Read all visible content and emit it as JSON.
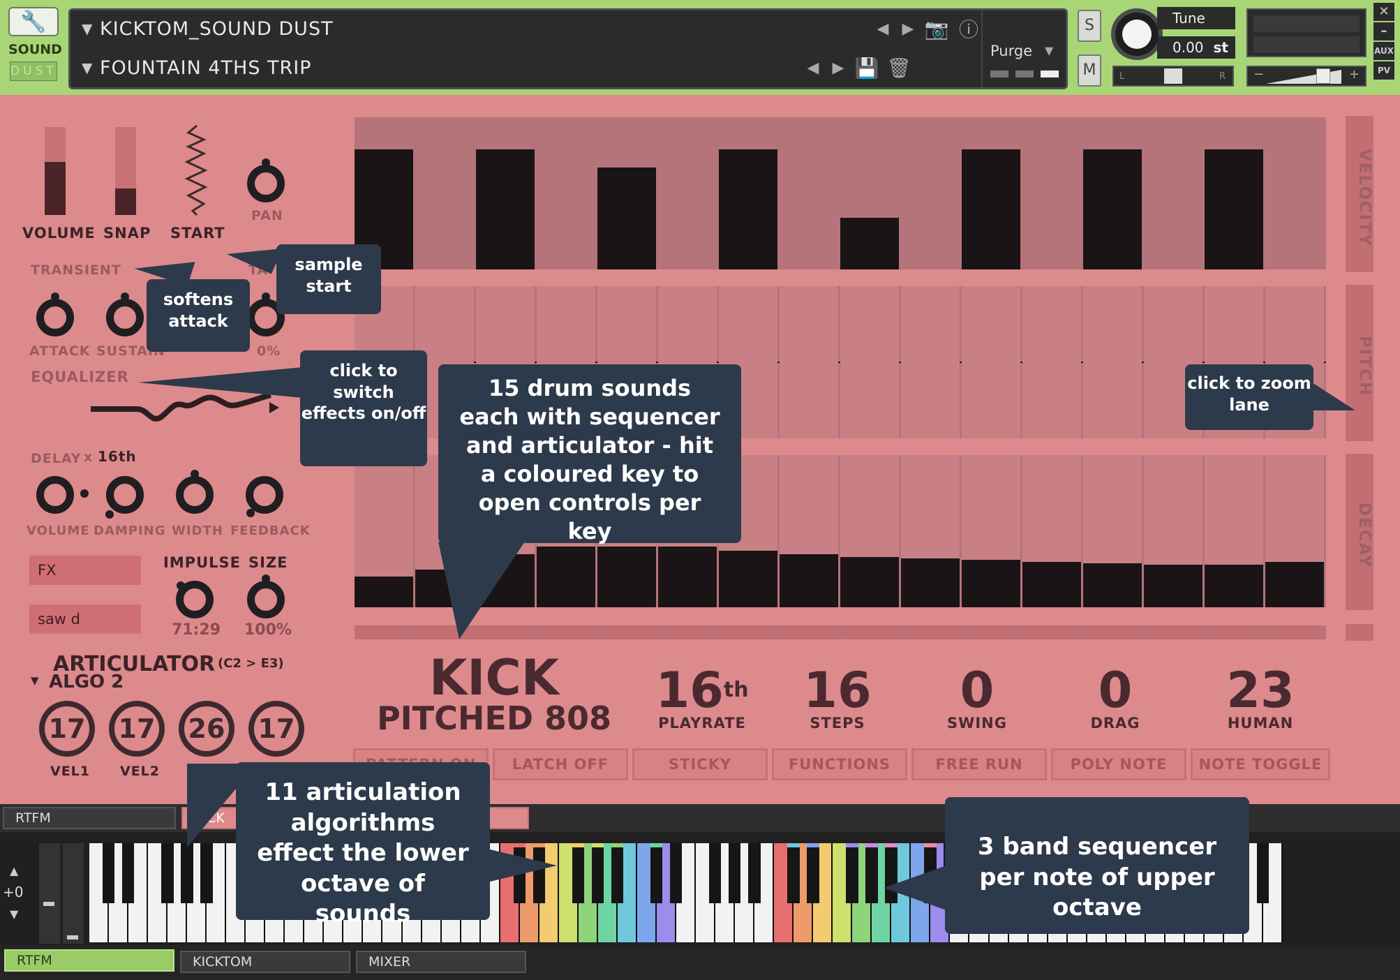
{
  "header": {
    "logo_top": "SOUND",
    "logo_bottom": "DUST",
    "instrument": "KICKTOM_SOUND DUST",
    "snapshot": "FOUNTAIN 4THS TRIP",
    "purge": "Purge",
    "solo": "S",
    "mute": "M",
    "tune_label": "Tune",
    "tune_value": "0.00",
    "tune_unit": "st",
    "pan_left": "L",
    "pan_right": "R",
    "vol_minus": "−",
    "vol_plus": "+",
    "aux": "AUX",
    "pv": "PV"
  },
  "controls": {
    "volume": "VOLUME",
    "snap": "SNAP",
    "start": "START",
    "pan": "PAN",
    "transient": "TRANSIENT",
    "tape_partial": "TA",
    "attack": "ATTACK",
    "sustain": "SUSTAIN",
    "zero_pct": "0%",
    "equalizer": "EQUALIZER",
    "delay": "DELAY",
    "delay_mult": "x",
    "delay_value": "16th",
    "d_volume": "VOLUME",
    "damping": "DAMPING",
    "width": "WIDTH",
    "feedback": "FEEDBACK",
    "fx": "FX",
    "impulse": "IMPULSE",
    "size": "SIZE",
    "impulse_value": "71:29",
    "size_value": "100%",
    "saw": "saw d",
    "volume_level": 0.6,
    "snap_level": 0.3
  },
  "articulator": {
    "title": "ARTICULATOR",
    "range": "(C2 > E3)",
    "algo": "ALGO 2",
    "knobs": [
      {
        "value": "17",
        "label": "VEL1"
      },
      {
        "value": "17",
        "label": "VEL2"
      },
      {
        "value": "26",
        "label": "VEL3"
      },
      {
        "value": "17",
        "label": ""
      }
    ]
  },
  "lanes": {
    "velocity": "VELOCITY",
    "pitch": "PITCH",
    "decay": "DECAY",
    "velocity_values": [
      0.79,
      0,
      0.79,
      0,
      0.67,
      0,
      0.79,
      0,
      0.34,
      0,
      0.79,
      0,
      0.79,
      0,
      0.79,
      0
    ],
    "decay_values": [
      0.2,
      0.25,
      0.35,
      0.4,
      0.4,
      0.4,
      0.37,
      0.35,
      0.33,
      0.32,
      0.31,
      0.3,
      0.29,
      0.28,
      0.28,
      0.3
    ]
  },
  "sound": {
    "name1": "KICK",
    "name2": "PITCHED 808",
    "playrate": "16",
    "playrate_sup": "th",
    "playrate_label": "PLAYRATE",
    "steps": "16",
    "steps_label": "STEPS",
    "swing": "0",
    "swing_label": "SWING",
    "drag": "0",
    "drag_label": "DRAG",
    "human": "23",
    "human_label": "HUMAN"
  },
  "buttons": {
    "pattern": "PATTERN ON",
    "latch": "LATCH OFF",
    "sticky": "STICKY",
    "functions": "FUNCTIONS",
    "free_run": "FREE RUN",
    "poly_note": "POLY NOTE",
    "note_toggle": "NOTE TOGGLE"
  },
  "tabs": {
    "rtfm": "RTFM",
    "kick": "KICK",
    "octave": "+0",
    "b_rtfm": "RTFM",
    "b_kicktom": "KICKTOM",
    "b_mixer": "MIXER"
  },
  "callouts": {
    "softens": "softens attack",
    "sample_start": "sample start",
    "switch_fx": "click to switch effects on/off",
    "drum": "15 drum sounds each with sequencer and articulator - hit a coloured key to open controls per key",
    "zoom": "click to zoom lane",
    "artic": "11 articulation algorithms effect the lower octave of sounds",
    "band": "3 band sequencer per note of upper octave"
  },
  "colors": {
    "top_bar": "#a8d676",
    "panel": "#dd8a8c",
    "callout": "#2d3a4b"
  }
}
